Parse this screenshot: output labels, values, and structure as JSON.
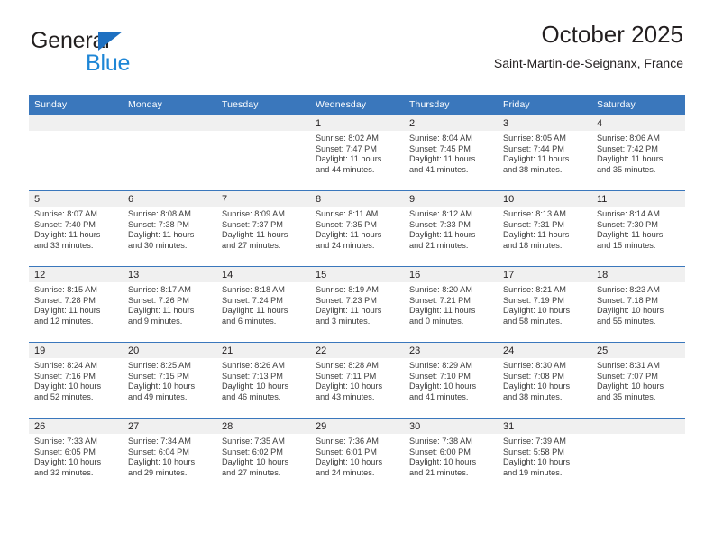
{
  "brand": {
    "name_top": "General",
    "name_bottom": "Blue",
    "triangle_color": "#1e70c1",
    "blue_color": "#1e86d6"
  },
  "header": {
    "title": "October 2025",
    "subtitle": "Saint-Martin-de-Seignanx, France"
  },
  "theme": {
    "header_blue": "#3a77bc",
    "daynum_band": "#f0f0f0",
    "text": "#231f20",
    "detail_text": "#3c3c3c"
  },
  "calendar": {
    "weekday_headers": [
      "Sunday",
      "Monday",
      "Tuesday",
      "Wednesday",
      "Thursday",
      "Friday",
      "Saturday"
    ],
    "weeks": [
      [
        {
          "day": "",
          "sunrise": "",
          "sunset": "",
          "daylight_line1": "",
          "daylight_line2": ""
        },
        {
          "day": "",
          "sunrise": "",
          "sunset": "",
          "daylight_line1": "",
          "daylight_line2": ""
        },
        {
          "day": "",
          "sunrise": "",
          "sunset": "",
          "daylight_line1": "",
          "daylight_line2": ""
        },
        {
          "day": "1",
          "sunrise": "Sunrise: 8:02 AM",
          "sunset": "Sunset: 7:47 PM",
          "daylight_line1": "Daylight: 11 hours",
          "daylight_line2": "and 44 minutes."
        },
        {
          "day": "2",
          "sunrise": "Sunrise: 8:04 AM",
          "sunset": "Sunset: 7:45 PM",
          "daylight_line1": "Daylight: 11 hours",
          "daylight_line2": "and 41 minutes."
        },
        {
          "day": "3",
          "sunrise": "Sunrise: 8:05 AM",
          "sunset": "Sunset: 7:44 PM",
          "daylight_line1": "Daylight: 11 hours",
          "daylight_line2": "and 38 minutes."
        },
        {
          "day": "4",
          "sunrise": "Sunrise: 8:06 AM",
          "sunset": "Sunset: 7:42 PM",
          "daylight_line1": "Daylight: 11 hours",
          "daylight_line2": "and 35 minutes."
        }
      ],
      [
        {
          "day": "5",
          "sunrise": "Sunrise: 8:07 AM",
          "sunset": "Sunset: 7:40 PM",
          "daylight_line1": "Daylight: 11 hours",
          "daylight_line2": "and 33 minutes."
        },
        {
          "day": "6",
          "sunrise": "Sunrise: 8:08 AM",
          "sunset": "Sunset: 7:38 PM",
          "daylight_line1": "Daylight: 11 hours",
          "daylight_line2": "and 30 minutes."
        },
        {
          "day": "7",
          "sunrise": "Sunrise: 8:09 AM",
          "sunset": "Sunset: 7:37 PM",
          "daylight_line1": "Daylight: 11 hours",
          "daylight_line2": "and 27 minutes."
        },
        {
          "day": "8",
          "sunrise": "Sunrise: 8:11 AM",
          "sunset": "Sunset: 7:35 PM",
          "daylight_line1": "Daylight: 11 hours",
          "daylight_line2": "and 24 minutes."
        },
        {
          "day": "9",
          "sunrise": "Sunrise: 8:12 AM",
          "sunset": "Sunset: 7:33 PM",
          "daylight_line1": "Daylight: 11 hours",
          "daylight_line2": "and 21 minutes."
        },
        {
          "day": "10",
          "sunrise": "Sunrise: 8:13 AM",
          "sunset": "Sunset: 7:31 PM",
          "daylight_line1": "Daylight: 11 hours",
          "daylight_line2": "and 18 minutes."
        },
        {
          "day": "11",
          "sunrise": "Sunrise: 8:14 AM",
          "sunset": "Sunset: 7:30 PM",
          "daylight_line1": "Daylight: 11 hours",
          "daylight_line2": "and 15 minutes."
        }
      ],
      [
        {
          "day": "12",
          "sunrise": "Sunrise: 8:15 AM",
          "sunset": "Sunset: 7:28 PM",
          "daylight_line1": "Daylight: 11 hours",
          "daylight_line2": "and 12 minutes."
        },
        {
          "day": "13",
          "sunrise": "Sunrise: 8:17 AM",
          "sunset": "Sunset: 7:26 PM",
          "daylight_line1": "Daylight: 11 hours",
          "daylight_line2": "and 9 minutes."
        },
        {
          "day": "14",
          "sunrise": "Sunrise: 8:18 AM",
          "sunset": "Sunset: 7:24 PM",
          "daylight_line1": "Daylight: 11 hours",
          "daylight_line2": "and 6 minutes."
        },
        {
          "day": "15",
          "sunrise": "Sunrise: 8:19 AM",
          "sunset": "Sunset: 7:23 PM",
          "daylight_line1": "Daylight: 11 hours",
          "daylight_line2": "and 3 minutes."
        },
        {
          "day": "16",
          "sunrise": "Sunrise: 8:20 AM",
          "sunset": "Sunset: 7:21 PM",
          "daylight_line1": "Daylight: 11 hours",
          "daylight_line2": "and 0 minutes."
        },
        {
          "day": "17",
          "sunrise": "Sunrise: 8:21 AM",
          "sunset": "Sunset: 7:19 PM",
          "daylight_line1": "Daylight: 10 hours",
          "daylight_line2": "and 58 minutes."
        },
        {
          "day": "18",
          "sunrise": "Sunrise: 8:23 AM",
          "sunset": "Sunset: 7:18 PM",
          "daylight_line1": "Daylight: 10 hours",
          "daylight_line2": "and 55 minutes."
        }
      ],
      [
        {
          "day": "19",
          "sunrise": "Sunrise: 8:24 AM",
          "sunset": "Sunset: 7:16 PM",
          "daylight_line1": "Daylight: 10 hours",
          "daylight_line2": "and 52 minutes."
        },
        {
          "day": "20",
          "sunrise": "Sunrise: 8:25 AM",
          "sunset": "Sunset: 7:15 PM",
          "daylight_line1": "Daylight: 10 hours",
          "daylight_line2": "and 49 minutes."
        },
        {
          "day": "21",
          "sunrise": "Sunrise: 8:26 AM",
          "sunset": "Sunset: 7:13 PM",
          "daylight_line1": "Daylight: 10 hours",
          "daylight_line2": "and 46 minutes."
        },
        {
          "day": "22",
          "sunrise": "Sunrise: 8:28 AM",
          "sunset": "Sunset: 7:11 PM",
          "daylight_line1": "Daylight: 10 hours",
          "daylight_line2": "and 43 minutes."
        },
        {
          "day": "23",
          "sunrise": "Sunrise: 8:29 AM",
          "sunset": "Sunset: 7:10 PM",
          "daylight_line1": "Daylight: 10 hours",
          "daylight_line2": "and 41 minutes."
        },
        {
          "day": "24",
          "sunrise": "Sunrise: 8:30 AM",
          "sunset": "Sunset: 7:08 PM",
          "daylight_line1": "Daylight: 10 hours",
          "daylight_line2": "and 38 minutes."
        },
        {
          "day": "25",
          "sunrise": "Sunrise: 8:31 AM",
          "sunset": "Sunset: 7:07 PM",
          "daylight_line1": "Daylight: 10 hours",
          "daylight_line2": "and 35 minutes."
        }
      ],
      [
        {
          "day": "26",
          "sunrise": "Sunrise: 7:33 AM",
          "sunset": "Sunset: 6:05 PM",
          "daylight_line1": "Daylight: 10 hours",
          "daylight_line2": "and 32 minutes."
        },
        {
          "day": "27",
          "sunrise": "Sunrise: 7:34 AM",
          "sunset": "Sunset: 6:04 PM",
          "daylight_line1": "Daylight: 10 hours",
          "daylight_line2": "and 29 minutes."
        },
        {
          "day": "28",
          "sunrise": "Sunrise: 7:35 AM",
          "sunset": "Sunset: 6:02 PM",
          "daylight_line1": "Daylight: 10 hours",
          "daylight_line2": "and 27 minutes."
        },
        {
          "day": "29",
          "sunrise": "Sunrise: 7:36 AM",
          "sunset": "Sunset: 6:01 PM",
          "daylight_line1": "Daylight: 10 hours",
          "daylight_line2": "and 24 minutes."
        },
        {
          "day": "30",
          "sunrise": "Sunrise: 7:38 AM",
          "sunset": "Sunset: 6:00 PM",
          "daylight_line1": "Daylight: 10 hours",
          "daylight_line2": "and 21 minutes."
        },
        {
          "day": "31",
          "sunrise": "Sunrise: 7:39 AM",
          "sunset": "Sunset: 5:58 PM",
          "daylight_line1": "Daylight: 10 hours",
          "daylight_line2": "and 19 minutes."
        },
        {
          "day": "",
          "sunrise": "",
          "sunset": "",
          "daylight_line1": "",
          "daylight_line2": ""
        }
      ]
    ]
  }
}
